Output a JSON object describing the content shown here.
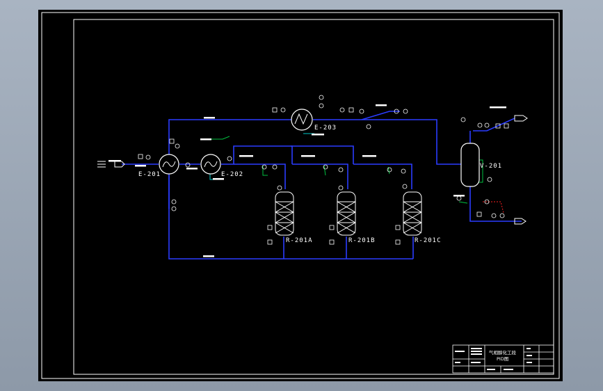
{
  "drawing": {
    "equipment": {
      "e201": "E-201",
      "e202": "E-202",
      "e203": "E-203",
      "r201a": "R-201A",
      "r201b": "R-201B",
      "r201c": "R-201C",
      "v201": "V-201"
    },
    "title_block": {
      "title_line1": "气相醇化工段",
      "title_line2": "PID图"
    }
  },
  "colors": {
    "background": "#000000",
    "frame": "#ffffff",
    "pipe": "#2a3cff",
    "instrument_line": "#00c040",
    "cyan_line": "#00c8c8",
    "red_line": "#ff2020"
  }
}
